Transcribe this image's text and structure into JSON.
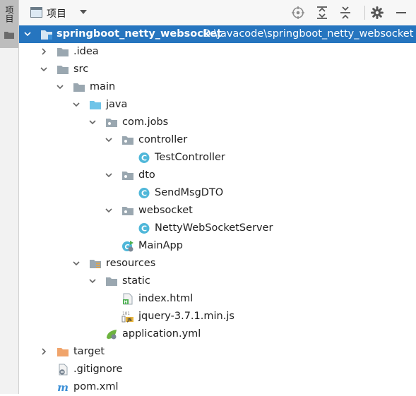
{
  "side_panel": {
    "tab_label": "项目"
  },
  "toolbar": {
    "view_label": "项目",
    "buttons": [
      "locate-icon",
      "expand-all-icon",
      "collapse-all-icon",
      "gear-icon",
      "minimize-icon"
    ]
  },
  "tree": {
    "root": {
      "name": "springboot_netty_websocket",
      "path": "D:\\javacode\\springboot_netty_websocket"
    },
    "items": [
      {
        "name": ".idea"
      },
      {
        "name": "src"
      },
      {
        "name": "main"
      },
      {
        "name": "java"
      },
      {
        "name": "com.jobs"
      },
      {
        "name": "controller"
      },
      {
        "name": "TestController"
      },
      {
        "name": "dto"
      },
      {
        "name": "SendMsgDTO"
      },
      {
        "name": "websocket"
      },
      {
        "name": "NettyWebSocketServer"
      },
      {
        "name": "MainApp"
      },
      {
        "name": "resources"
      },
      {
        "name": "static"
      },
      {
        "name": "index.html"
      },
      {
        "name": "jquery-3.7.1.min.js"
      },
      {
        "name": "application.yml"
      },
      {
        "name": "target"
      },
      {
        "name": ".gitignore"
      },
      {
        "name": "pom.xml"
      }
    ]
  },
  "colors": {
    "selection": "#2675bf",
    "folder": "#9aa7b0",
    "source_folder": "#6fc4e8",
    "class_icon": "#4fb7d9",
    "target_folder": "#f0a46b"
  }
}
